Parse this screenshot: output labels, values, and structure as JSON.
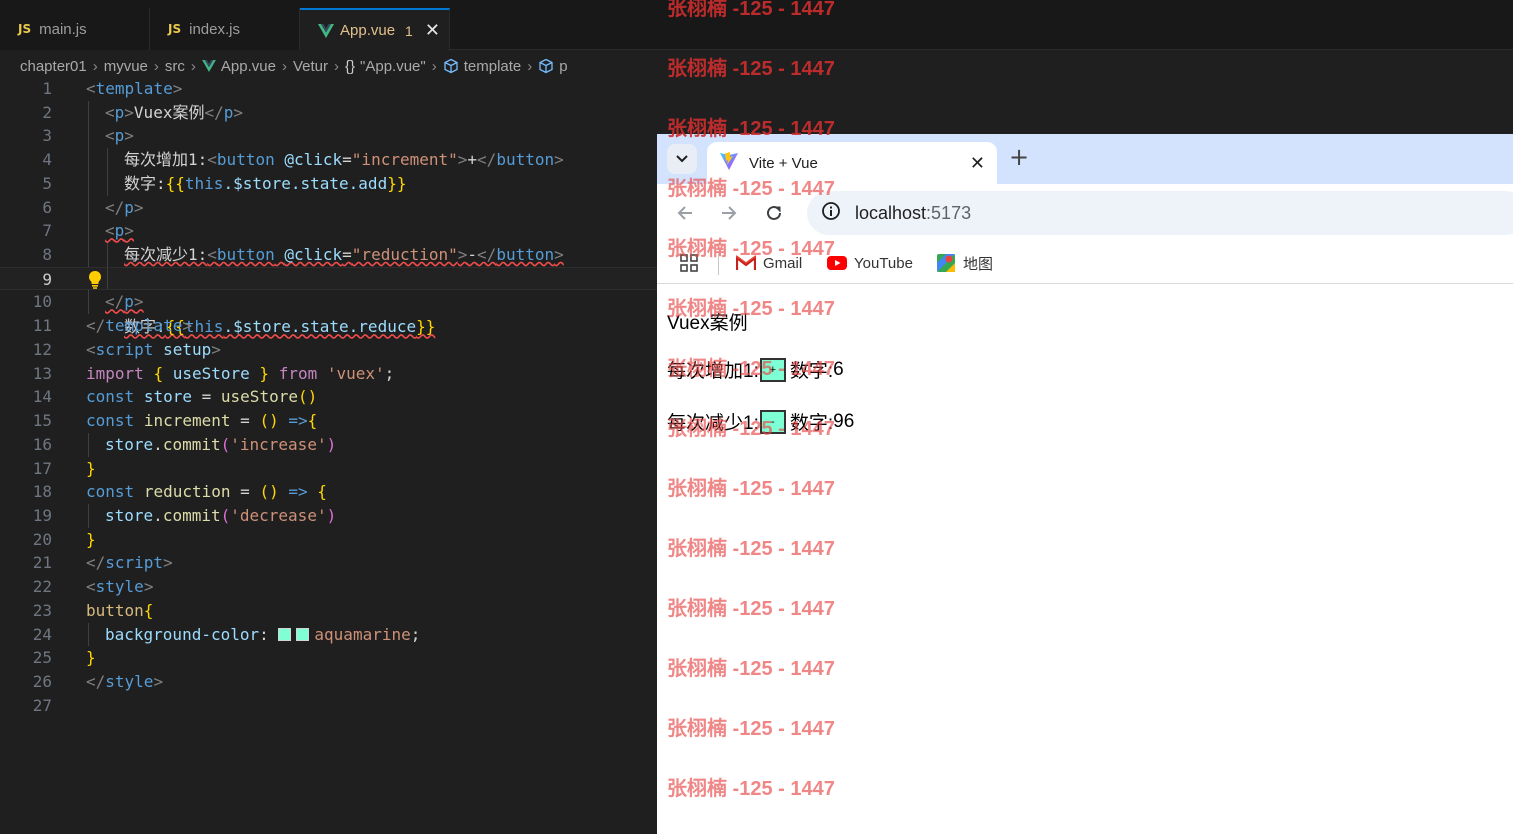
{
  "editor": {
    "tabs": [
      {
        "icon": "JS",
        "label": "main.js"
      },
      {
        "icon": "JS",
        "label": "index.js"
      },
      {
        "label": "App.vue",
        "badge": "1",
        "close": "✕"
      }
    ],
    "breadcrumb": [
      "chapter01",
      "myvue",
      "src",
      "App.vue",
      "Vetur",
      "\"App.vue\"",
      "template",
      "p"
    ],
    "breadcrumb_brace": "{}",
    "line_numbers": [
      "1",
      "2",
      "3",
      "4",
      "5",
      "6",
      "7",
      "8",
      "9",
      "10",
      "11",
      "12",
      "13",
      "14",
      "15",
      "16",
      "17",
      "18",
      "19",
      "20",
      "21",
      "22",
      "23",
      "24",
      "25",
      "26",
      "27"
    ],
    "code": {
      "l1": {
        "lt": "<",
        "tag": "template",
        "gt": ">"
      },
      "l2": {
        "lt": "<",
        "tag": "p",
        "gt": ">",
        "text": "Vuex案例",
        "close_lt": "</",
        "close_tag": "p",
        "close_gt": ">"
      },
      "l3": {
        "lt": "<",
        "tag": "p",
        "gt": ">"
      },
      "l4": {
        "text": "每次增加1:",
        "lt": "<",
        "tag": "button",
        "attr": "@click",
        "eq": "=",
        "str": "\"increment\"",
        "gt": ">",
        "inner": "+",
        "close_lt": "</",
        "close_tag": "button",
        "close_gt": ">"
      },
      "l5": {
        "text": "数字:",
        "open": "{{",
        "this": "this",
        "expr": ".$store.state.add",
        "close": "}}"
      },
      "l6": {
        "close_lt": "</",
        "close_tag": "p",
        "close_gt": ">"
      },
      "l7": {
        "lt": "<",
        "tag": "p",
        "gt": ">"
      },
      "l8": {
        "text": "每次减少1:",
        "lt": "<",
        "tag": "button",
        "attr": "@click",
        "eq": "=",
        "str": "\"reduction\"",
        "gt": ">",
        "inner": "-",
        "close_lt": "</",
        "close_tag": "button",
        "close_gt": ">"
      },
      "l9": {
        "text": "数字:",
        "open": "{{",
        "this": "this",
        "expr": ".$store.state.reduce",
        "close": "}}"
      },
      "l10": {
        "close_lt": "</",
        "close_tag": "p",
        "close_gt": ">"
      },
      "l11": {
        "close_lt": "</",
        "close_tag": "template",
        "close_gt": ">"
      },
      "l12": {
        "lt": "<",
        "tag": "script",
        "attr": "setup",
        "gt": ">"
      },
      "l13": {
        "kw": "import",
        "b_open": "{",
        "name": "useStore",
        "b_close": "}",
        "from": "from",
        "str": "'vuex'",
        "semi": ";"
      },
      "l14": {
        "kw": "const",
        "name": "store",
        "eq": "=",
        "fn": "useStore",
        "parens": "()"
      },
      "l15": {
        "kw": "const",
        "name": "increment",
        "eq": "=",
        "parens": "()",
        "arrow": "=>",
        "brace": "{"
      },
      "l16": {
        "obj": "store",
        "dot": ".",
        "fn": "commit",
        "p_open": "(",
        "str": "'increase'",
        "p_close": ")"
      },
      "l17": {
        "brace": "}"
      },
      "l18": {
        "kw": "const",
        "name": "reduction",
        "eq": "=",
        "parens": "()",
        "arrow": "=>",
        "brace": "{"
      },
      "l19": {
        "obj": "store",
        "dot": ".",
        "fn": "commit",
        "p_open": "(",
        "str": "'decrease'",
        "p_close": ")"
      },
      "l20": {
        "brace": "}"
      },
      "l21": {
        "close_lt": "</",
        "close_tag": "script",
        "close_gt": ">"
      },
      "l22": {
        "lt": "<",
        "tag": "style",
        "gt": ">"
      },
      "l23": {
        "sel": "button",
        "brace": "{"
      },
      "l24": {
        "prop": "background-color",
        "colon": ":",
        "val": "aquamarine",
        "semi": ";"
      },
      "l25": {
        "brace": "}"
      },
      "l26": {
        "close_lt": "</",
        "close_tag": "style",
        "close_gt": ">"
      }
    }
  },
  "browser": {
    "tab_title": "Vite + Vue",
    "tab_close": "✕",
    "new_tab": "+",
    "url_host": "localhost",
    "url_port": ":5173",
    "bookmarks": [
      "Gmail",
      "YouTube",
      "地图"
    ],
    "page": {
      "heading": "Vuex案例",
      "inc_label": "每次增加1:",
      "inc_button": "+",
      "inc_count_label": "数字:",
      "inc_count": "6",
      "dec_label": "每次减少1:",
      "dec_button": "-",
      "dec_count_label": "数字:",
      "dec_count": "96"
    }
  },
  "watermark": "张栩楠 -125 - 1447",
  "colors": {
    "editor_bg": "#1f1f1f",
    "accent": "#0078d4",
    "button_bg": "#7fffd4",
    "watermark": "#e84646"
  }
}
